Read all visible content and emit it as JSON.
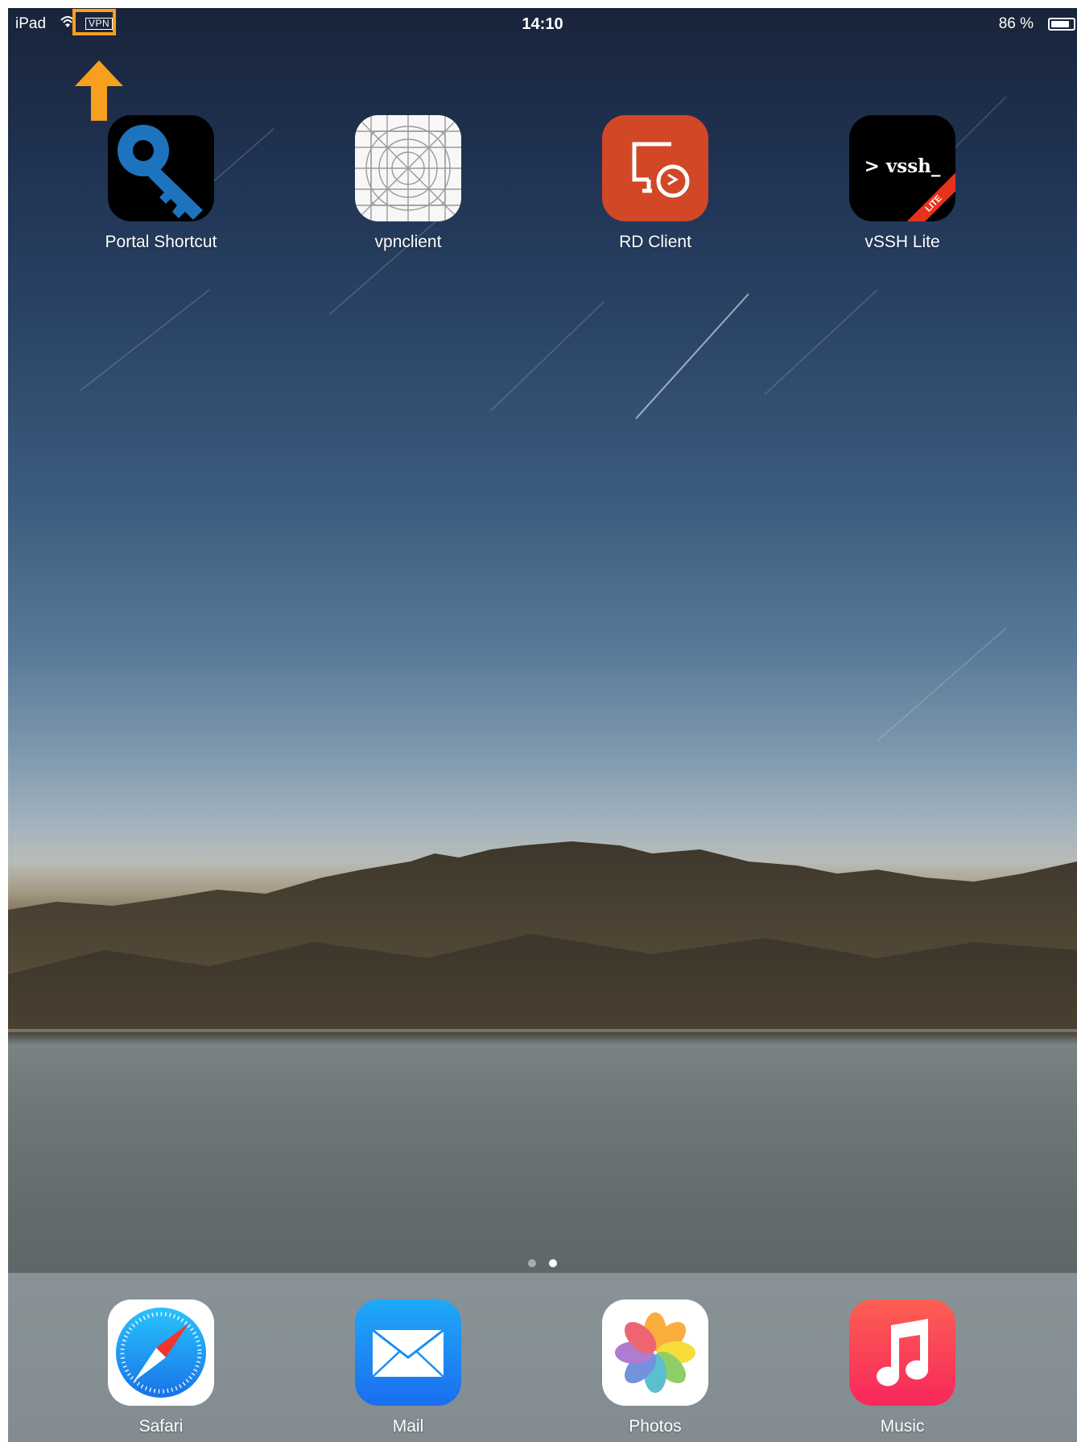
{
  "status_bar": {
    "carrier": "iPad",
    "vpn": "VPN",
    "time": "14:10",
    "battery": "86 %",
    "battery_level": 0.86
  },
  "annotation": {
    "highlight_color": "#f7a01d"
  },
  "home_apps": [
    {
      "label": "Portal Shortcut",
      "icon": "key-icon"
    },
    {
      "label": "vpnclient",
      "icon": "placeholder-grid-icon"
    },
    {
      "label": "RD Client",
      "icon": "remote-desktop-icon"
    },
    {
      "label": "vSSH Lite",
      "icon": "terminal-icon",
      "icon_text": "> vssh_",
      "ribbon": "LITE"
    }
  ],
  "page_indicator": {
    "pages": 2,
    "current": 2
  },
  "dock_apps": [
    {
      "label": "Safari",
      "icon": "compass-icon"
    },
    {
      "label": "Mail",
      "icon": "envelope-icon"
    },
    {
      "label": "Photos",
      "icon": "flower-icon"
    },
    {
      "label": "Music",
      "icon": "music-note-icon"
    }
  ]
}
